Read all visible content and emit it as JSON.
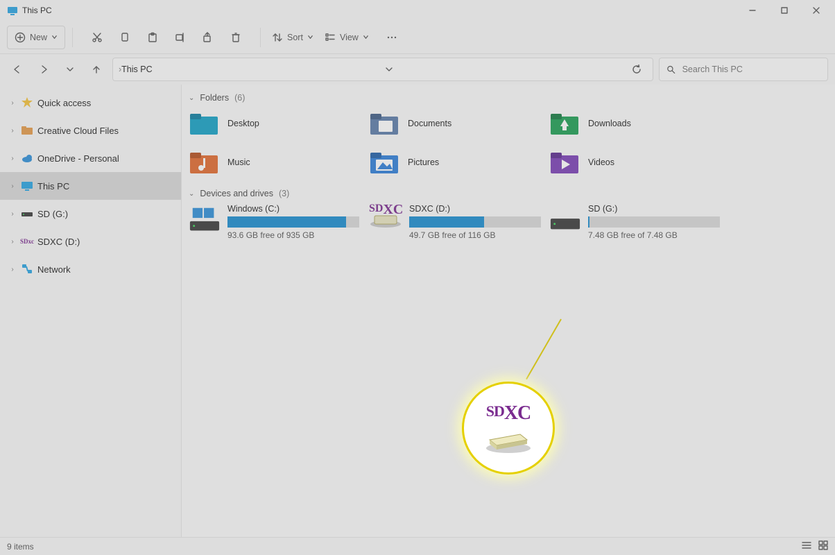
{
  "title": "This PC",
  "toolbar": {
    "new_label": "New",
    "sort_label": "Sort",
    "view_label": "View"
  },
  "breadcrumb": [
    "This PC"
  ],
  "search": {
    "placeholder": "Search This PC"
  },
  "sidebar": {
    "items": [
      {
        "label": "Quick access",
        "icon": "star"
      },
      {
        "label": "Creative Cloud Files",
        "icon": "cc"
      },
      {
        "label": "OneDrive - Personal",
        "icon": "cloud"
      },
      {
        "label": "This PC",
        "icon": "pc",
        "selected": true
      },
      {
        "label": "SD (G:)",
        "icon": "drive"
      },
      {
        "label": "SDXC (D:)",
        "icon": "sdxc"
      },
      {
        "label": "Network",
        "icon": "network"
      }
    ]
  },
  "folders_header": "Folders",
  "folders_count": "(6)",
  "folders": [
    {
      "label": "Desktop"
    },
    {
      "label": "Documents"
    },
    {
      "label": "Downloads"
    },
    {
      "label": "Music"
    },
    {
      "label": "Pictures"
    },
    {
      "label": "Videos"
    }
  ],
  "drives_header": "Devices and drives",
  "drives_count": "(3)",
  "drives": [
    {
      "label": "Windows (C:)",
      "free": "93.6 GB free of 935 GB",
      "fill_pct": 90
    },
    {
      "label": "SDXC (D:)",
      "free": "49.7 GB free of 116 GB",
      "fill_pct": 57
    },
    {
      "label": "SD (G:)",
      "free": "7.48 GB free of 7.48 GB",
      "fill_pct": 1
    }
  ],
  "status": {
    "items": "9 items"
  },
  "callout": {
    "label_sd": "SD",
    "label_xc": "XC"
  }
}
